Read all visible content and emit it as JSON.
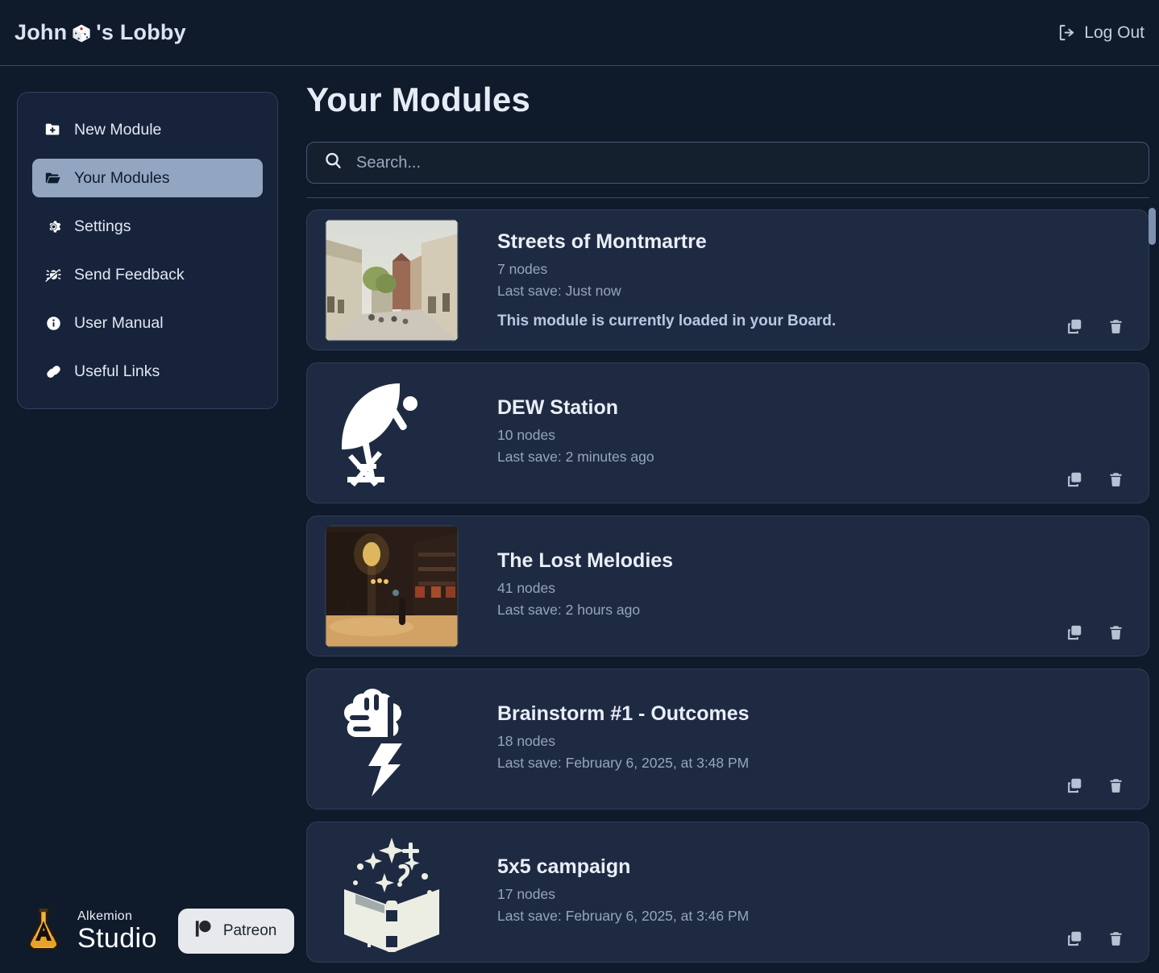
{
  "header": {
    "user_name": "John",
    "title_suffix": "'s Lobby",
    "dice_icon": "dice-icon",
    "logout_label": "Log Out",
    "logout_icon": "logout-icon"
  },
  "sidebar": {
    "items": [
      {
        "label": "New Module",
        "icon": "folder-plus-icon",
        "active": false
      },
      {
        "label": "Your Modules",
        "icon": "folder-open-icon",
        "active": true
      },
      {
        "label": "Settings",
        "icon": "gear-icon",
        "active": false
      },
      {
        "label": "Send Feedback",
        "icon": "bug-slash-icon",
        "active": false
      },
      {
        "label": "User Manual",
        "icon": "info-circle-icon",
        "active": false
      },
      {
        "label": "Useful Links",
        "icon": "link-chain-icon",
        "active": false
      }
    ]
  },
  "brand": {
    "logo_icon": "alkemion-flask-icon",
    "name_top": "Alkemion",
    "name_bottom": "Studio",
    "patreon_label": "Patreon",
    "patreon_icon": "patreon-icon"
  },
  "main": {
    "page_title": "Your Modules",
    "search": {
      "placeholder": "Search...",
      "value": "",
      "icon": "search-icon"
    },
    "actions": {
      "duplicate_icon": "copy-icon",
      "delete_icon": "trash-icon"
    },
    "modules": [
      {
        "title": "Streets of Montmartre",
        "nodes": "7 nodes",
        "last_save": "Last save: Just now",
        "note": "This module is currently loaded in your Board.",
        "thumb_type": "image-daytime-street"
      },
      {
        "title": "DEW Station",
        "nodes": "10 nodes",
        "last_save": "Last save: 2 minutes ago",
        "note": "",
        "thumb_type": "satellite-dish-icon"
      },
      {
        "title": "The Lost Melodies",
        "nodes": "41 nodes",
        "last_save": "Last save: 2 hours ago",
        "note": "",
        "thumb_type": "image-night-street"
      },
      {
        "title": "Brainstorm #1 - Outcomes",
        "nodes": "18 nodes",
        "last_save": "Last save: February 6, 2025, at 3:48 PM",
        "note": "",
        "thumb_type": "brain-storm-icon"
      },
      {
        "title": "5x5 campaign",
        "nodes": "17 nodes",
        "last_save": "Last save: February 6, 2025, at 3:46 PM",
        "note": "",
        "thumb_type": "magic-book-icon"
      }
    ]
  },
  "colors": {
    "page_bg": "#0f1a2b",
    "card_bg": "#1e2a42",
    "panel_bg": "#16233a",
    "accent_active": "#92a6c2",
    "text_primary": "#e6ecf5",
    "text_muted": "#95a5bd",
    "brand_orange": "#e8a227"
  }
}
